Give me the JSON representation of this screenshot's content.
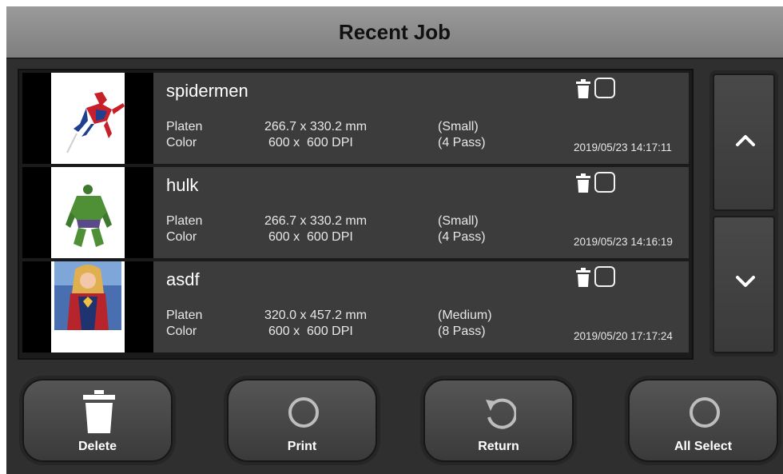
{
  "header": {
    "title": "Recent Job"
  },
  "jobs": [
    {
      "name": "spidermen",
      "platen_label": "Platen",
      "size": "266.7 x 330.2 mm",
      "platen_size": "(Small)",
      "color_label": "Color",
      "dpi": "600 x  600 DPI",
      "pass": "(4 Pass)",
      "date": "2019/05/23 14:17:11",
      "thumbnail_icon": "spiderman-image",
      "selected": false
    },
    {
      "name": "hulk",
      "platen_label": "Platen",
      "size": "266.7 x 330.2 mm",
      "platen_size": "(Small)",
      "color_label": "Color",
      "dpi": "600 x  600 DPI",
      "pass": "(4 Pass)",
      "date": "2019/05/23 14:16:19",
      "thumbnail_icon": "hulk-image",
      "selected": false
    },
    {
      "name": "asdf",
      "platen_label": "Platen",
      "size": "320.0 x 457.2 mm",
      "platen_size": "(Medium)",
      "color_label": "Color",
      "dpi": "600 x  600 DPI",
      "pass": "(8 Pass)",
      "date": "2019/05/20 17:17:24",
      "thumbnail_icon": "captain-marvel-image",
      "selected": false
    }
  ],
  "scroll": {
    "up_icon": "chevron-up-icon",
    "down_icon": "chevron-down-icon"
  },
  "actions": [
    {
      "label": "Delete",
      "icon": "trash-icon"
    },
    {
      "label": "Print",
      "icon": "circle-icon"
    },
    {
      "label": "Return",
      "icon": "rotate-icon"
    },
    {
      "label": "All Select",
      "icon": "circle-icon"
    }
  ],
  "colors": {
    "background": "#2f2f2f",
    "titlebar": "#8a8a8a",
    "row": "#3c3c3c",
    "text": "#ffffff"
  }
}
